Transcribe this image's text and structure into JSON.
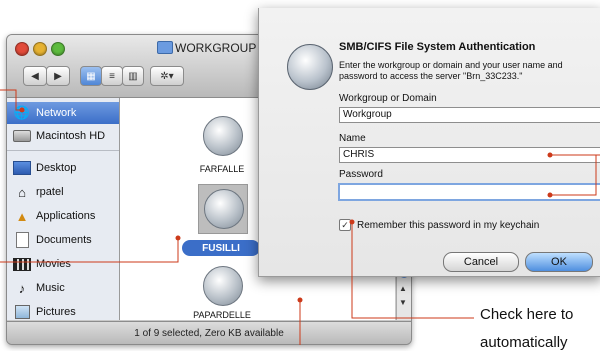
{
  "finder": {
    "title": "WORKGROUP",
    "toolbar": {
      "back_label": "◀",
      "forward_label": "▶",
      "icon_view_label": "▦",
      "list_view_label": "≡",
      "column_view_label": "▥",
      "action_label": "✲▾"
    },
    "sidebar": {
      "items": [
        {
          "label": "Network",
          "icon": "network-icon"
        },
        {
          "label": "Macintosh HD",
          "icon": "hard-drive-icon"
        },
        {
          "label": "Desktop",
          "icon": "desktop-icon"
        },
        {
          "label": "rpatel",
          "icon": "home-icon"
        },
        {
          "label": "Applications",
          "icon": "applications-icon"
        },
        {
          "label": "Documents",
          "icon": "documents-icon"
        },
        {
          "label": "Movies",
          "icon": "movies-icon"
        },
        {
          "label": "Music",
          "icon": "music-icon"
        },
        {
          "label": "Pictures",
          "icon": "pictures-icon"
        }
      ]
    },
    "servers": [
      {
        "label": "FARFALLE"
      },
      {
        "label": "FUSILLI"
      },
      {
        "label": "PAPARDELLE"
      }
    ],
    "status": "1 of 9 selected, Zero KB available"
  },
  "dialog": {
    "title": "SMB/CIFS File System Authentication",
    "message": "Enter the workgroup or domain and your user name and password to access the server \"Brn_33C233.\"",
    "workgroup_label": "Workgroup or Domain",
    "workgroup_value": "Workgroup",
    "name_label": "Name",
    "name_value": "CHRIS",
    "password_label": "Password",
    "password_value": "",
    "remember_label": "Remember this password in my keychain",
    "remember_checked": "✓",
    "cancel_label": "Cancel",
    "ok_label": "OK"
  },
  "callout": {
    "line1": "Check here to",
    "line2": "automatically"
  },
  "colors": {
    "callout_line": "#cc3a1a",
    "selection": "#3b6ec8"
  }
}
